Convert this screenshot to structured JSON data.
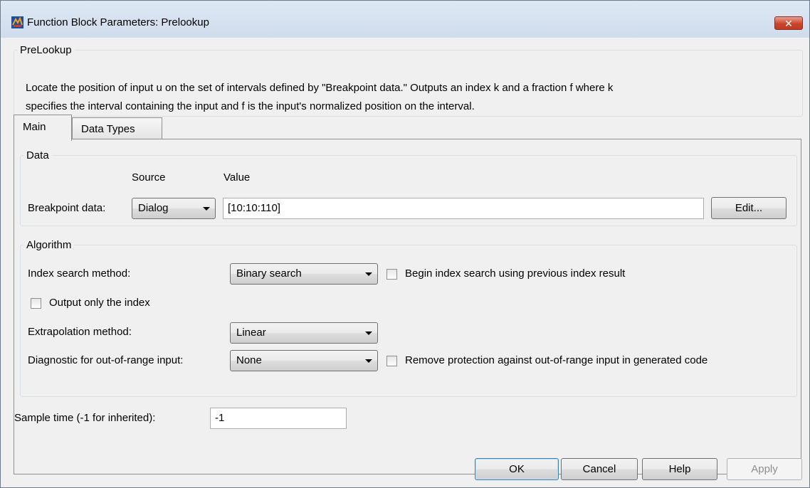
{
  "window": {
    "title": "Function Block Parameters: Prelookup",
    "close_glyph": "✕"
  },
  "description": {
    "group_label": "PreLookup",
    "text_line1": "Locate the position of input u on the set of intervals defined by \"Breakpoint data.\" Outputs an index k and a fraction f where k",
    "text_line2": "specifies the interval containing the input and f is the input's normalized position on the interval."
  },
  "tabs": [
    {
      "label": "Main",
      "active": true
    },
    {
      "label": "Data Types",
      "active": false
    }
  ],
  "data_group": {
    "label": "Data",
    "source_header": "Source",
    "value_header": "Value",
    "breakpoint_label": "Breakpoint data:",
    "source_value": "Dialog",
    "breakpoint_value": "[10:10:110]",
    "edit_button": "Edit..."
  },
  "algorithm_group": {
    "label": "Algorithm",
    "index_search_label": "Index search method:",
    "index_search_value": "Binary search",
    "begin_index_label": "Begin index search using previous index result",
    "begin_index_checked": false,
    "output_index_label": "Output only the index",
    "output_index_checked": false,
    "extrapolation_label": "Extrapolation method:",
    "extrapolation_value": "Linear",
    "diagnostic_label": "Diagnostic for out-of-range input:",
    "diagnostic_value": "None",
    "remove_protection_label": "Remove protection against out-of-range input in generated code",
    "remove_protection_checked": false
  },
  "sample_time": {
    "label": "Sample time (-1 for inherited):",
    "value": "-1"
  },
  "buttons": {
    "ok": "OK",
    "cancel": "Cancel",
    "help": "Help",
    "apply": "Apply"
  },
  "colors": {
    "titlebar": "#dfe9f5",
    "close": "#c9452c",
    "dialog_bg": "#f0f0f0"
  }
}
